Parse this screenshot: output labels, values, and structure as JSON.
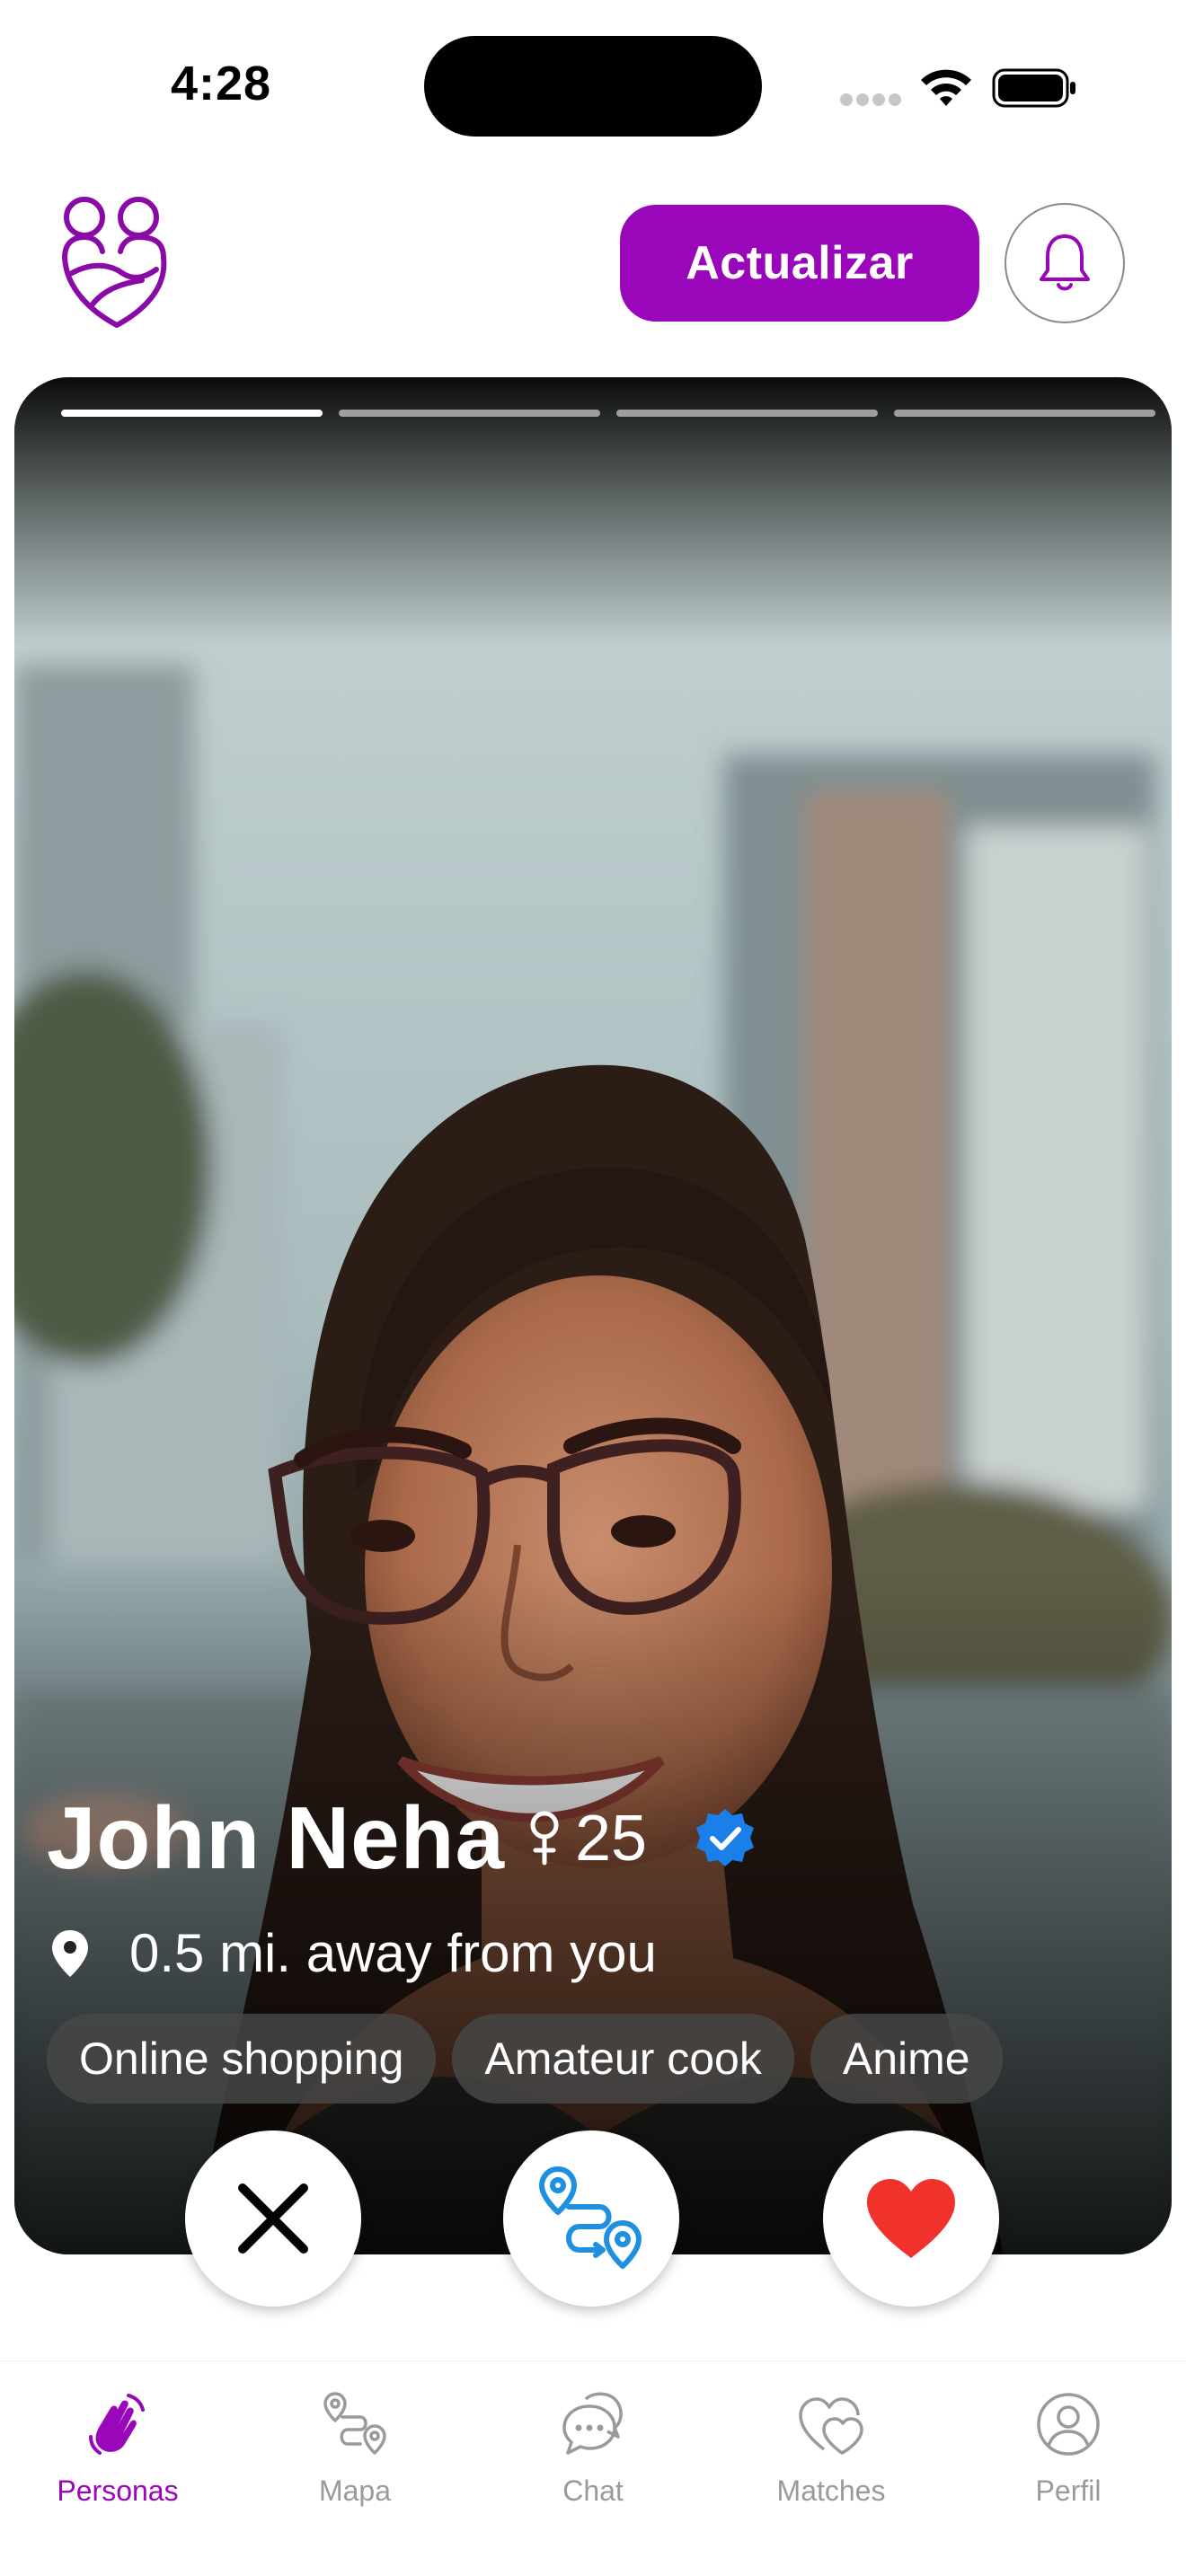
{
  "status_bar": {
    "time": "4:28"
  },
  "header": {
    "upgrade_label": "Actualizar"
  },
  "profile": {
    "name": "John Neha",
    "age": "25",
    "distance": "0.5 mi. away from you",
    "photo_count": 4,
    "current_photo": 1,
    "tags": [
      "Online shopping",
      "Amateur cook",
      "Anime"
    ]
  },
  "bottom_nav": {
    "items": [
      {
        "label": "Personas",
        "icon": "hand-wave-icon",
        "active": true
      },
      {
        "label": "Mapa",
        "icon": "route-icon",
        "active": false
      },
      {
        "label": "Chat",
        "icon": "chat-bubbles-icon",
        "active": false
      },
      {
        "label": "Matches",
        "icon": "hearts-icon",
        "active": false
      },
      {
        "label": "Perfil",
        "icon": "user-circle-icon",
        "active": false
      }
    ]
  },
  "colors": {
    "brand": "#9a06b9",
    "like": "#f0312c",
    "match": "#1f8fe0",
    "verified": "#1a7fe8",
    "inactive": "#9a9a9a"
  }
}
